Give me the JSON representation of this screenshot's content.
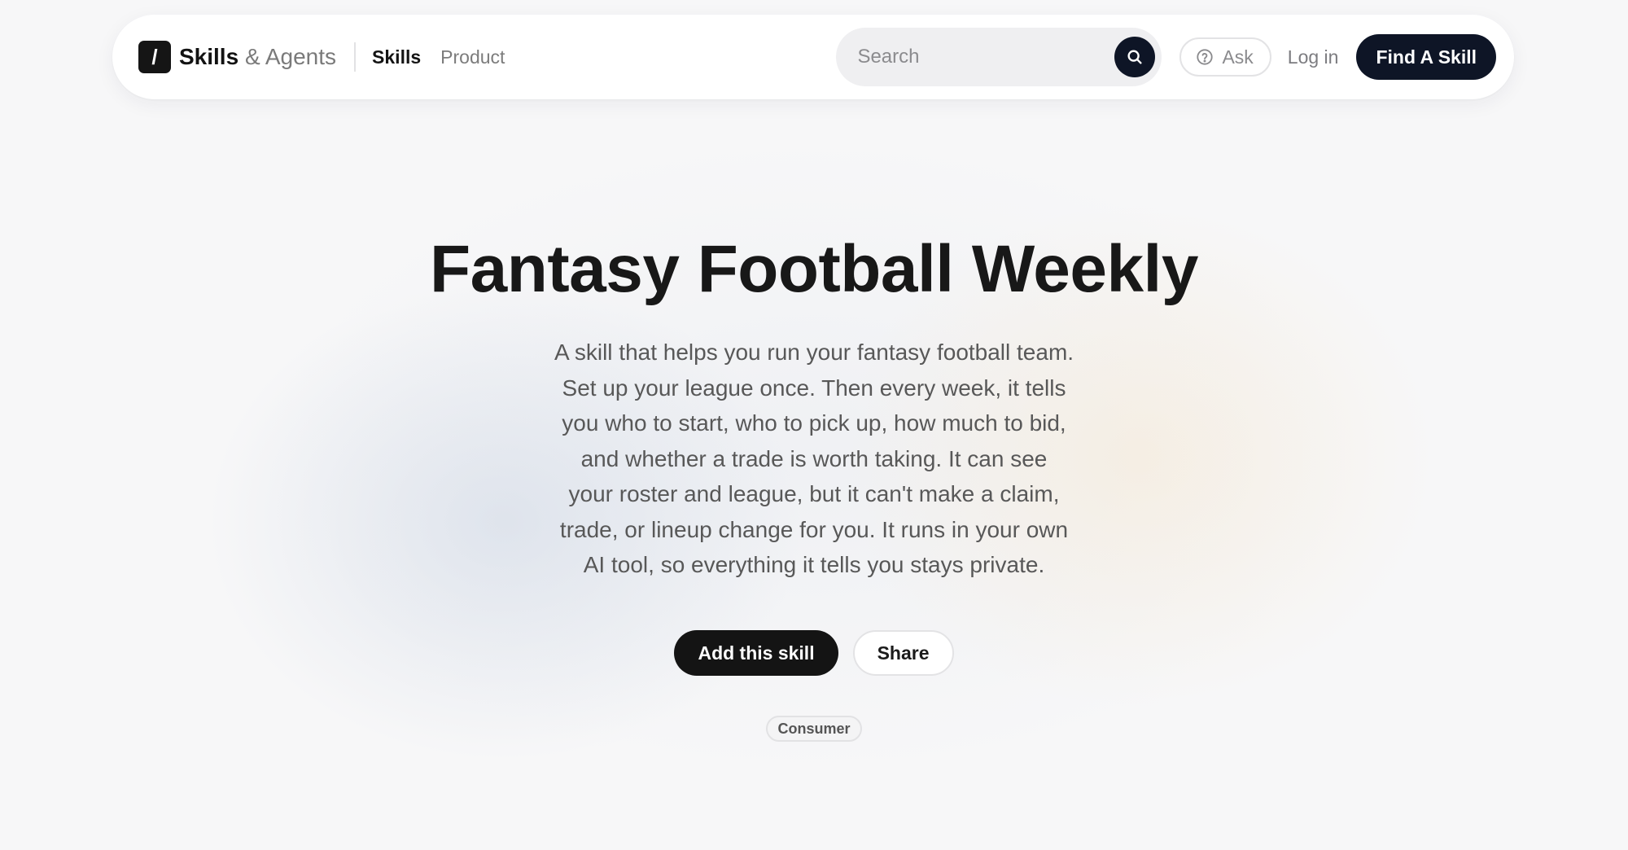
{
  "header": {
    "brand": {
      "mark": "/",
      "name_strong": "Skills",
      "name_light": "& Agents"
    },
    "nav": [
      {
        "label": "Skills",
        "active": true
      },
      {
        "label": "Product",
        "active": false
      }
    ],
    "search": {
      "placeholder": "Search",
      "value": "",
      "icon": "search-icon"
    },
    "ask": {
      "label": "Ask",
      "icon": "question-circle-icon"
    },
    "login_label": "Log in",
    "cta_label": "Find A Skill"
  },
  "hero": {
    "title": "Fantasy Football Weekly",
    "description_lines": [
      "A skill that helps you run your fantasy football team.",
      "Set up your league once. Then every week, it tells",
      "you who to start, who to pick up, how much to bid,",
      "and whether a trade is worth taking. It can see",
      "your roster and league, but it can't make a claim,",
      "trade, or lineup change for you. It runs in your own",
      "AI tool, so everything it tells you stays private."
    ],
    "primary_button": "Add this skill",
    "secondary_button": "Share",
    "tag": "Consumer"
  },
  "colors": {
    "dark_navy": "#0e1526",
    "primary_black": "#141414",
    "muted_text": "#585858"
  }
}
